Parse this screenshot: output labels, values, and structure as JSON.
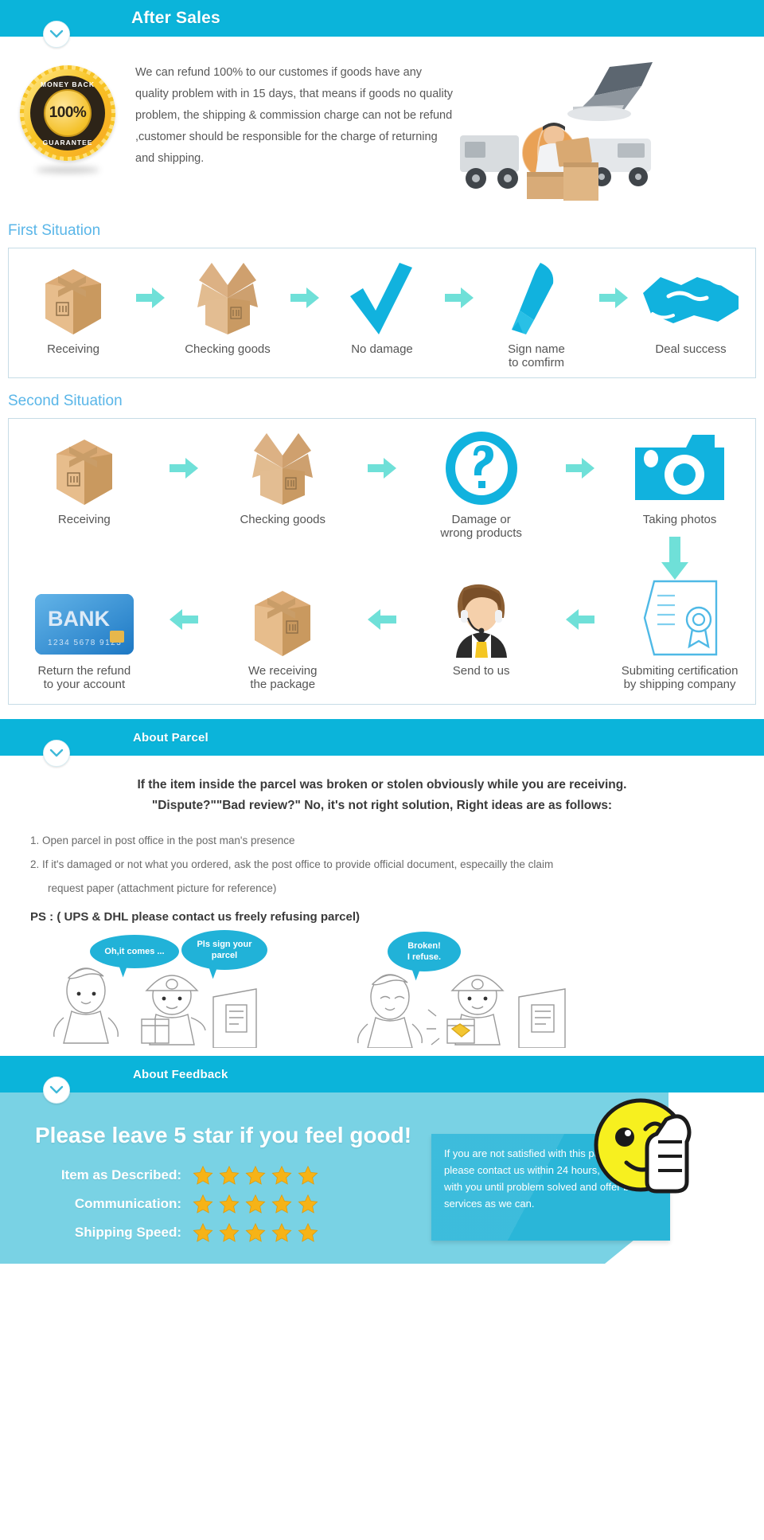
{
  "sections": {
    "after_sales": {
      "title": "After Sales",
      "refund_text": "We can refund 100% to our customes if goods have any quality problem with in 15 days, that means if goods no quality problem, the shipping & commission charge can not be refund ,customer should be responsible  for the charge of returning and shipping.",
      "badge": {
        "top": "MONEY BACK",
        "percent": "100%",
        "bottom": "GUARANTEE"
      }
    },
    "first_situation": {
      "title": "First Situation",
      "steps": [
        {
          "label": "Receiving",
          "icon": "closed-box-icon"
        },
        {
          "label": "Checking goods",
          "icon": "open-box-icon"
        },
        {
          "label": "No damage",
          "icon": "checkmark-icon"
        },
        {
          "label": "Sign name\nto comfirm",
          "label_line1": "Sign name",
          "label_line2": "to comfirm",
          "icon": "pen-icon"
        },
        {
          "label": "Deal success",
          "icon": "handshake-icon"
        }
      ]
    },
    "second_situation": {
      "title": "Second Situation",
      "row1": [
        {
          "label": "Receiving",
          "icon": "closed-box-icon"
        },
        {
          "label": "Checking goods",
          "icon": "open-box-icon"
        },
        {
          "label_line1": "Damage or",
          "label_line2": "wrong products",
          "icon": "question-mark-icon"
        },
        {
          "label": "Taking photos",
          "icon": "camera-icon"
        }
      ],
      "row2": [
        {
          "label_line1": "Return the refund",
          "label_line2": "to your account",
          "icon": "bank-card-icon",
          "card_brand": "BANK",
          "card_number": "1234 5678 9123"
        },
        {
          "label_line1": "We receiving",
          "label_line2": "the package",
          "icon": "closed-box-icon"
        },
        {
          "label": "Send to us",
          "icon": "support-agent-icon"
        },
        {
          "label_line1": "Submiting certification",
          "label_line2": "by shipping company",
          "icon": "certificate-icon"
        }
      ]
    },
    "about_parcel": {
      "title": "About Parcel",
      "headline_line1": "If the item inside the parcel was broken or stolen obviously while you are receiving.",
      "headline_line2": "\"Dispute?\"\"Bad review?\" No, it's not right solution, Right ideas are as follows:",
      "items": [
        "1. Open parcel in post office in the post man's presence",
        "2. If it's damaged or not what you ordered, ask the post office to provide official document, especailly the claim",
        "request paper (attachment picture for reference)"
      ],
      "ps": "PS :  ( UPS & DHL please contact us freely refusing parcel)",
      "bubbles": [
        {
          "text": "Oh,it comes ...",
          "line1": "Oh,it comes ...",
          "line2": ""
        },
        {
          "text": "Pls sign your parcel",
          "line1": "Pls sign your",
          "line2": "parcel"
        },
        {
          "text": "Broken! I refuse.",
          "line1": "Broken!",
          "line2": "I refuse."
        }
      ]
    },
    "about_feedback": {
      "title": "About Feedback",
      "headline": "Please leave 5 star if you feel good!",
      "ratings": [
        {
          "label": "Item as Described:",
          "stars": 5
        },
        {
          "label": "Communication:",
          "stars": 5
        },
        {
          "label": "Shipping Speed:",
          "stars": 5
        }
      ],
      "note": "If you are not satisfied with this purchase, please contact us within 24 hours, we will stay with you until problem solved and offer best services as we can."
    }
  },
  "colors": {
    "brand_cyan": "#0bb4da",
    "light_cyan": "#79d2e4",
    "note_cyan": "#2ab6d8",
    "arrow_cyan": "#6fe0d8",
    "icon_blue": "#11b2de",
    "section_title_blue": "#5ab6e8",
    "star_gold": "#f6b317",
    "box_tan": "#d8ab78"
  }
}
